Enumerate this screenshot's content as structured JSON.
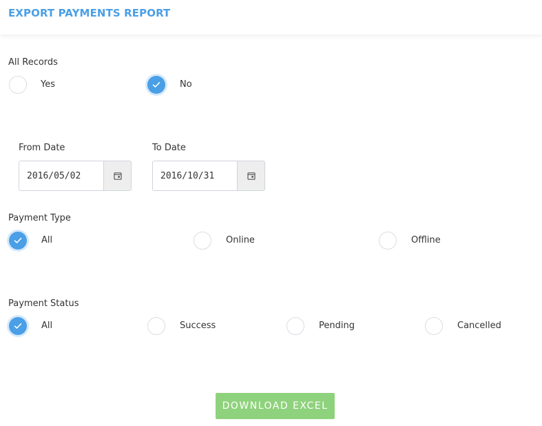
{
  "header": {
    "title": "EXPORT PAYMENTS REPORT"
  },
  "all_records": {
    "label": "All Records",
    "options": [
      {
        "label": "Yes",
        "checked": false
      },
      {
        "label": "No",
        "checked": true
      }
    ]
  },
  "from_date": {
    "label": "From Date",
    "value": "2016/05/02"
  },
  "to_date": {
    "label": "To Date",
    "value": "2016/10/31"
  },
  "payment_type": {
    "label": "Payment Type",
    "options": [
      {
        "label": "All",
        "checked": true
      },
      {
        "label": "Online",
        "checked": false
      },
      {
        "label": "Offline",
        "checked": false
      }
    ]
  },
  "payment_status": {
    "label": "Payment Status",
    "options": [
      {
        "label": "All",
        "checked": true
      },
      {
        "label": "Success",
        "checked": false
      },
      {
        "label": "Pending",
        "checked": false
      },
      {
        "label": "Cancelled",
        "checked": false
      }
    ]
  },
  "download_button": {
    "label": "DOWNLOAD EXCEL"
  },
  "colors": {
    "accent": "#4a9fe6",
    "success_button": "#8fd27d"
  }
}
